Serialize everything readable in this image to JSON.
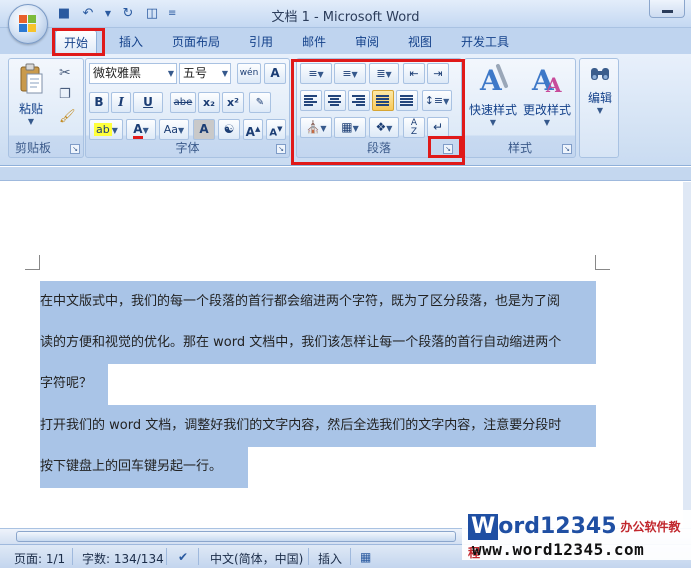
{
  "window": {
    "title": "文档 1 - Microsoft Word"
  },
  "tabs": [
    {
      "label": "开始",
      "active": true
    },
    {
      "label": "插入"
    },
    {
      "label": "页面布局"
    },
    {
      "label": "引用"
    },
    {
      "label": "邮件"
    },
    {
      "label": "审阅"
    },
    {
      "label": "视图"
    },
    {
      "label": "开发工具"
    }
  ],
  "ribbon": {
    "clipboard": {
      "label": "剪贴板",
      "paste_label": "粘贴"
    },
    "font": {
      "label": "字体",
      "font_name": "微软雅黑",
      "font_size": "五号",
      "bold": "B",
      "italic": "I",
      "underline": "U",
      "strike": "abe",
      "subscript": "x₂",
      "superscript": "x²",
      "change_case": "Aa",
      "grow": "A",
      "shrink": "A",
      "phonetic": "wén"
    },
    "paragraph": {
      "label": "段落"
    },
    "styles": {
      "label": "样式",
      "quick_styles": "快速样式",
      "change_styles": "更改样式"
    },
    "editing": {
      "label": "编辑"
    }
  },
  "document": {
    "lines": [
      "在中文版式中，我们的每一个段落的首行都会缩进两个字符，既为了区分段落，也是为了阅",
      "读的方便和视觉的优化。那在 word 文档中，我们该怎样让每一个段落的首行自动缩进两个",
      "字符呢？",
      "打开我们的 word 文档，调整好我们的文字内容，然后全选我们的文字内容，注意要分段时",
      "按下键盘上的回车键另起一行。"
    ]
  },
  "status": {
    "page": "页面: 1/1",
    "words": "字数: 134/134",
    "language": "中文(简体，中国)",
    "mode": "插入"
  },
  "watermark": {
    "brand_w": "W",
    "brand_rest": "ord12345",
    "brand_cn": "办公软件教程",
    "url": "www.word12345.com"
  },
  "colors": {
    "highlight": "#a9c4e7",
    "annotation_red": "#e01919",
    "ribbon_text": "#15428b"
  }
}
